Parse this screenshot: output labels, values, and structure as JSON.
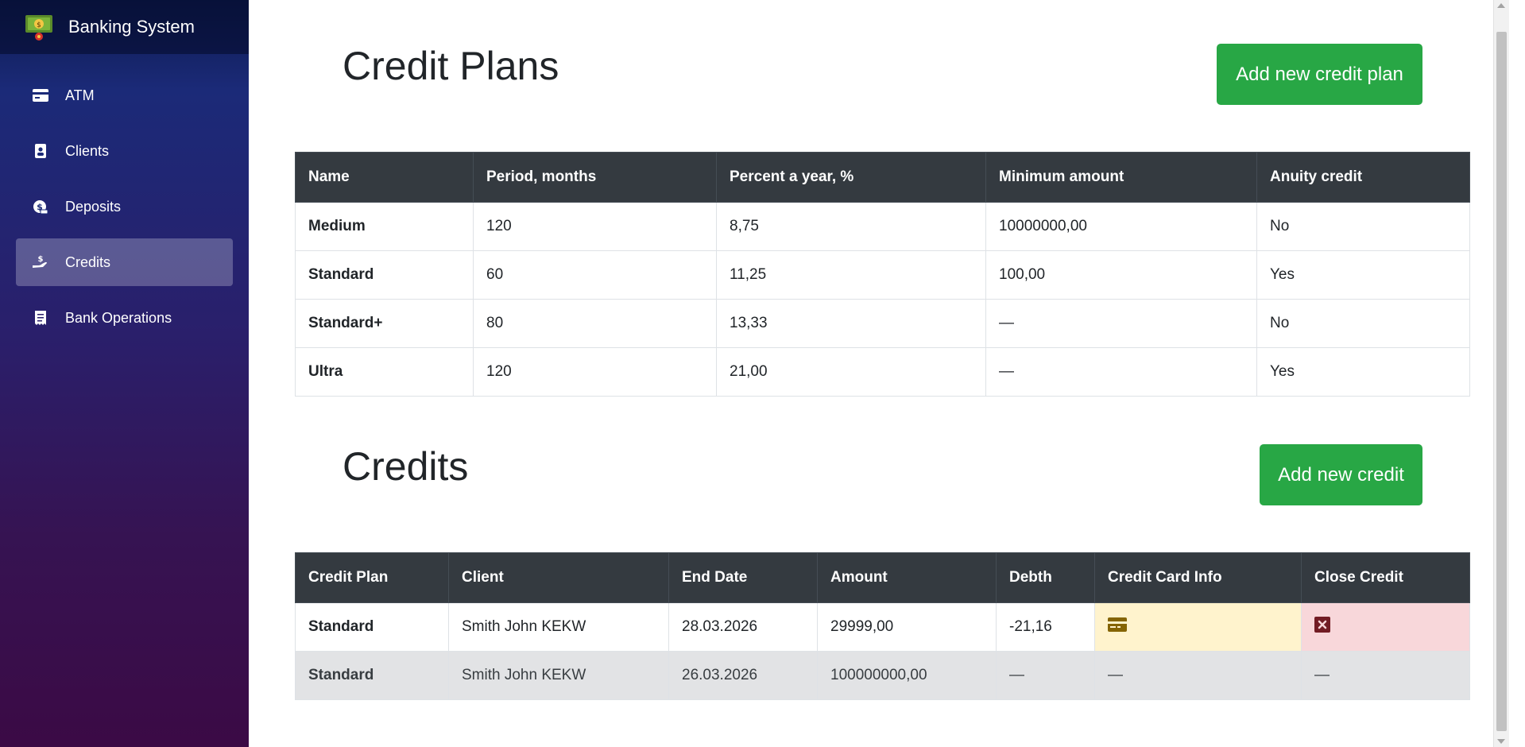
{
  "app": {
    "title": "Banking System"
  },
  "sidebar": {
    "items": [
      {
        "label": "ATM",
        "icon": "credit-card-icon",
        "active": false
      },
      {
        "label": "Clients",
        "icon": "contact-card-icon",
        "active": false
      },
      {
        "label": "Deposits",
        "icon": "money-bag-icon",
        "active": false
      },
      {
        "label": "Credits",
        "icon": "hand-holding-dollar-icon",
        "active": true
      },
      {
        "label": "Bank Operations",
        "icon": "receipt-icon",
        "active": false
      }
    ]
  },
  "credit_plans": {
    "title": "Credit Plans",
    "add_button": "Add new credit plan",
    "columns": [
      "Name",
      "Period, months",
      "Percent a year, %",
      "Minimum amount",
      "Anuity credit"
    ],
    "rows": [
      [
        "Medium",
        "120",
        "8,75",
        "10000000,00",
        "No"
      ],
      [
        "Standard",
        "60",
        "11,25",
        "100,00",
        "Yes"
      ],
      [
        "Standard+",
        "80",
        "13,33",
        "—",
        "No"
      ],
      [
        "Ultra",
        "120",
        "21,00",
        "—",
        "Yes"
      ]
    ]
  },
  "credits": {
    "title": "Credits",
    "add_button": "Add new credit",
    "columns": [
      "Credit Plan",
      "Client",
      "End Date",
      "Amount",
      "Debth",
      "Credit Card Info",
      "Close Credit"
    ],
    "rows": [
      [
        "Standard",
        "Smith John KEKW",
        "28.03.2026",
        "29999,00",
        "-21,16",
        "",
        ""
      ],
      [
        "Standard",
        "Smith John KEKW",
        "26.03.2026",
        "100000000,00",
        "—",
        "—",
        "—"
      ]
    ]
  },
  "colors": {
    "success": "#28a745",
    "table_header": "#343a40",
    "warning_cell": "#fff3cd",
    "danger_cell": "#f8d7da",
    "muted_row": "#e2e3e5"
  }
}
